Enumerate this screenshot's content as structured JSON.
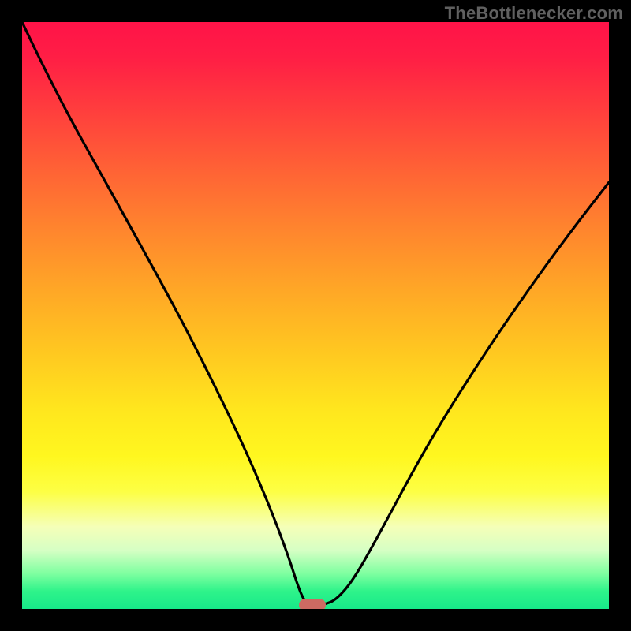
{
  "attribution": "TheBottlenecker.com",
  "colors": {
    "frame": "#000000",
    "curve_stroke": "#000000",
    "marker": "#cc6a62",
    "attribution_text": "#606060"
  },
  "chart_data": {
    "type": "line",
    "title": "",
    "xlabel": "",
    "ylabel": "",
    "xlim": [
      0,
      100
    ],
    "ylim": [
      0,
      100
    ],
    "x": [
      0,
      3.6,
      7.9,
      13.4,
      20.2,
      27.4,
      33.3,
      38.4,
      42.5,
      45.4,
      46.9,
      48.0,
      49.0,
      50.0,
      51.3,
      53.5,
      56.5,
      61.1,
      67.2,
      72.8,
      80.2,
      87.5,
      93.8,
      100.0
    ],
    "values": [
      100,
      92.5,
      84.1,
      74.2,
      62.0,
      48.8,
      37.1,
      26.4,
      16.7,
      8.9,
      4.2,
      1.5,
      0.7,
      0.7,
      0.7,
      1.5,
      5.0,
      13.2,
      24.6,
      34.1,
      45.6,
      56.1,
      64.7,
      72.7
    ],
    "marker_point": {
      "x": 49.5,
      "y": 0.7
    },
    "gradient_stops": [
      {
        "pos": 0.0,
        "color": "#ff1348"
      },
      {
        "pos": 0.06,
        "color": "#ff1e45"
      },
      {
        "pos": 0.14,
        "color": "#ff3a3e"
      },
      {
        "pos": 0.24,
        "color": "#ff5e36"
      },
      {
        "pos": 0.35,
        "color": "#ff842e"
      },
      {
        "pos": 0.46,
        "color": "#ffa826"
      },
      {
        "pos": 0.57,
        "color": "#ffca20"
      },
      {
        "pos": 0.66,
        "color": "#ffe61e"
      },
      {
        "pos": 0.74,
        "color": "#fff71f"
      },
      {
        "pos": 0.8,
        "color": "#fdff44"
      },
      {
        "pos": 0.86,
        "color": "#f5ffb8"
      },
      {
        "pos": 0.9,
        "color": "#d6ffc4"
      },
      {
        "pos": 0.94,
        "color": "#7effa0"
      },
      {
        "pos": 0.97,
        "color": "#2ef38a"
      },
      {
        "pos": 1.0,
        "color": "#17e989"
      }
    ]
  }
}
